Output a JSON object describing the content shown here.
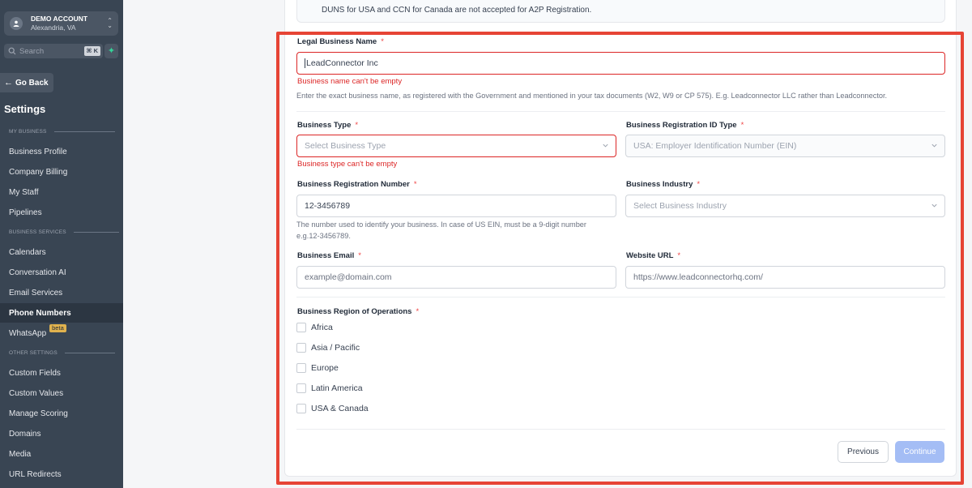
{
  "sidebar": {
    "account": {
      "name": "DEMO ACCOUNT",
      "location": "Alexandria, VA"
    },
    "search": {
      "placeholder": "Search",
      "shortcut": "⌘ K"
    },
    "go_back": "Go Back",
    "title": "Settings",
    "sections": {
      "my_business": "MY BUSINESS",
      "business_services": "BUSINESS SERVICES",
      "other_settings": "OTHER SETTINGS"
    },
    "items": [
      {
        "label": "Business Profile"
      },
      {
        "label": "Company Billing"
      },
      {
        "label": "My Staff"
      },
      {
        "label": "Pipelines"
      },
      {
        "label": "Calendars"
      },
      {
        "label": "Conversation AI"
      },
      {
        "label": "Email Services"
      },
      {
        "label": "Phone Numbers",
        "active": true
      },
      {
        "label": "WhatsApp",
        "badge": "beta"
      },
      {
        "label": "Custom Fields"
      },
      {
        "label": "Custom Values"
      },
      {
        "label": "Manage Scoring"
      },
      {
        "label": "Domains"
      },
      {
        "label": "Media"
      },
      {
        "label": "URL Redirects"
      }
    ]
  },
  "notice": "DUNS for USA and CCN for Canada are not accepted for A2P Registration.",
  "form": {
    "legal_name": {
      "label": "Legal Business Name",
      "value": "LeadConnector Inc",
      "error": "Business name can't be empty",
      "help": "Enter the exact business name, as registered with the Government and mentioned in your tax documents (W2, W9 or CP 575). E.g. Leadconnector LLC rather than Leadconnector."
    },
    "business_type": {
      "label": "Business Type",
      "placeholder": "Select Business Type",
      "error": "Business type can't be empty"
    },
    "registration_id_type": {
      "label": "Business Registration ID Type",
      "value": "USA: Employer Identification Number (EIN)"
    },
    "registration_number": {
      "label": "Business Registration Number",
      "value": "12-3456789",
      "help_line1": "The number used to identify your business. In case of US EIN, must be a 9-digit number",
      "help_line2": "e.g.12-3456789."
    },
    "industry": {
      "label": "Business Industry",
      "placeholder": "Select Business Industry"
    },
    "email": {
      "label": "Business Email",
      "placeholder": "example@domain.com"
    },
    "website": {
      "label": "Website URL",
      "placeholder": "https://www.leadconnectorhq.com/"
    },
    "regions": {
      "label": "Business Region of Operations",
      "options": [
        "Africa",
        "Asia / Pacific",
        "Europe",
        "Latin America",
        "USA & Canada"
      ]
    },
    "required_mark": "*"
  },
  "buttons": {
    "previous": "Previous",
    "continue": "Continue"
  },
  "colors": {
    "sidebar": "#394553",
    "error": "#dc2626",
    "highlight": "#e64435",
    "primary_disabled": "#a4bdf5"
  }
}
